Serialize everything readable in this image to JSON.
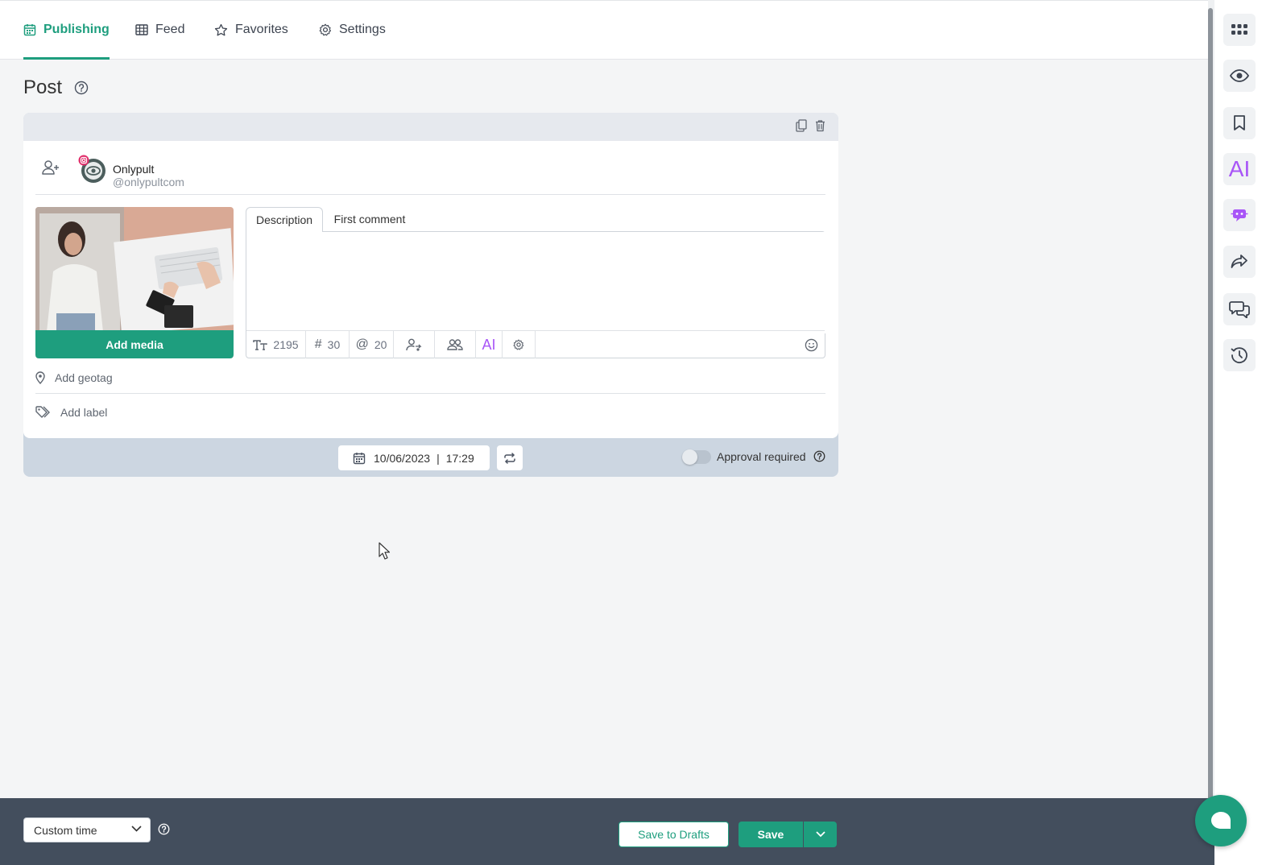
{
  "nav": {
    "tabs": [
      {
        "label": "Publishing",
        "icon": "calendar-icon",
        "active": true
      },
      {
        "label": "Feed",
        "icon": "grid-icon",
        "active": false
      },
      {
        "label": "Favorites",
        "icon": "star-icon",
        "active": false
      },
      {
        "label": "Settings",
        "icon": "gear-icon",
        "active": false
      }
    ]
  },
  "page": {
    "title": "Post"
  },
  "account": {
    "name": "Onlypult",
    "handle": "@onlypultcom",
    "network": "instagram"
  },
  "media": {
    "add_label": "Add media"
  },
  "editor": {
    "tabs": [
      "Description",
      "First comment"
    ],
    "active_tab": "Description",
    "text": "",
    "counters": {
      "chars": "2195",
      "hashtags": "30",
      "mentions": "20"
    },
    "ai_label": "AI"
  },
  "geotag": {
    "label": "Add geotag"
  },
  "label": {
    "label": "Add label"
  },
  "schedule": {
    "date": "10/06/2023",
    "separator": "|",
    "time": "17:29"
  },
  "approval": {
    "label": "Approval required",
    "enabled": false
  },
  "rail": {
    "ai_label": "AI"
  },
  "footer": {
    "time_mode": "Custom time",
    "save_drafts_label": "Save to Drafts",
    "save_label": "Save"
  },
  "colors": {
    "accent": "#1e9e7e",
    "ai": "#a855f7",
    "footer": "#434e5d",
    "instagram": "#e1306c"
  }
}
